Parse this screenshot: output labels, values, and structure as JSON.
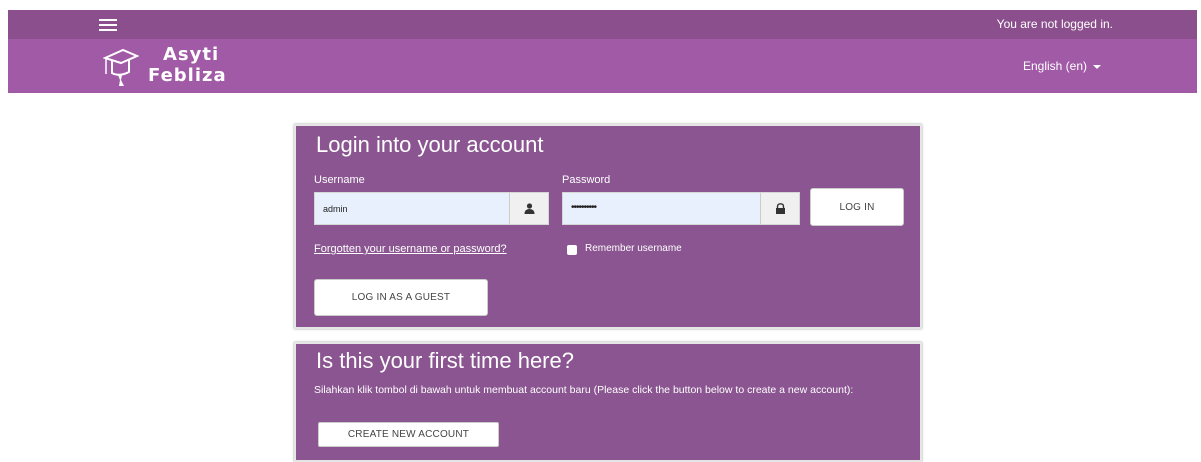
{
  "header": {
    "status_text": "You are not logged in.",
    "brand_line1": "Asyti",
    "brand_line2": "Febliza",
    "language_label": "English (en)"
  },
  "login": {
    "title": "Login into your account",
    "username_label": "Username",
    "username_value": "admin",
    "password_label": "Password",
    "password_value": "••••••••••",
    "login_button": "LOG IN",
    "forgot_link": "Forgotten your username or password?",
    "remember_label": "Remember username",
    "remember_checked": false,
    "guest_button": "LOG IN AS A GUEST"
  },
  "signup": {
    "title": "Is this your first time here?",
    "description": "Silahkan klik tombol di bawah untuk membuat account baru (Please click the button below to create a new account):",
    "create_button": "CREATE NEW ACCOUNT"
  },
  "theme": {
    "topbar_color": "#8a4f8c",
    "brandbar_color": "#a05aa6",
    "card_color": "#8a5590"
  },
  "icons": {
    "menu": "hamburger-icon",
    "logo": "graduation-cap-icon",
    "user": "user-icon",
    "lock": "lock-icon",
    "dropdown": "caret-down-icon"
  }
}
